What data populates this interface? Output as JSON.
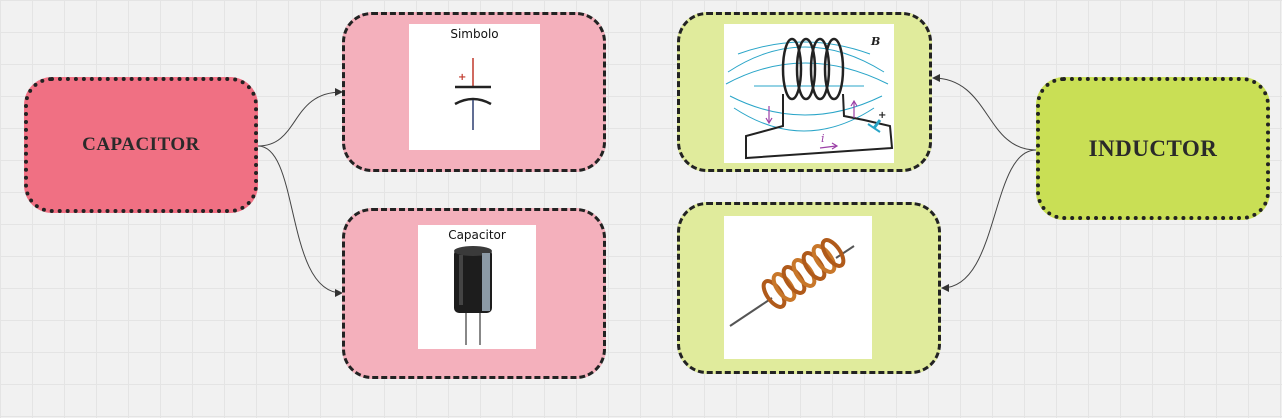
{
  "capacitor": {
    "title": "CAPACITOR",
    "color": "#f07083",
    "card_color": "#f4b0bc",
    "symbol_card": {
      "caption": "Simbolo",
      "plus_sign": "+"
    },
    "photo_card": {
      "caption": "Capacitor"
    }
  },
  "inductor": {
    "title": "INDUCTOR",
    "color": "#c9df55",
    "card_color": "#e0eb9c",
    "field_card": {
      "field_label": "B",
      "current_label": "i",
      "plus_sign": "+"
    },
    "photo_card": {}
  }
}
